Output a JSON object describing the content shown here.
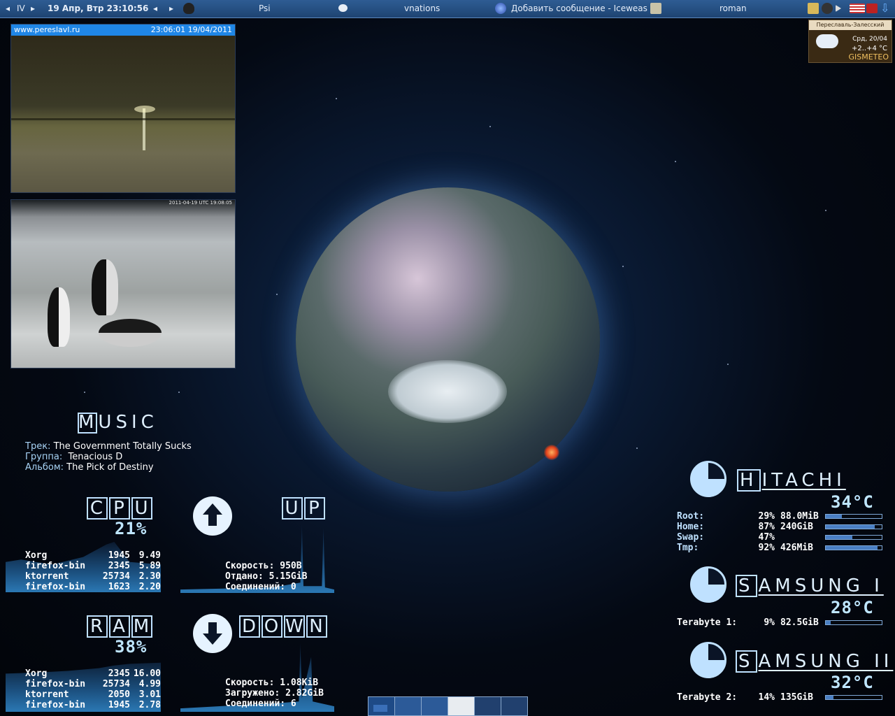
{
  "panel": {
    "desktop": "IV",
    "clock": "19 Апр, Втр 23:10:56",
    "tasks": [
      "Psi",
      "vnations",
      "Добавить сообщение - Iceweas",
      "roman"
    ]
  },
  "weather": {
    "city": "Переславль-Залесский",
    "date": "Срд, 20/04",
    "temp": "+2..+4 °C",
    "brand": "GISMETEO"
  },
  "webcam1": {
    "site": "www.pereslavl.ru",
    "timestamp": "23:06:01 19/04/2011"
  },
  "webcam2": {
    "timestamp": "2011-04-19 UTC 19:08:05"
  },
  "music": {
    "header": "MUSIC",
    "track_label": "Трек:",
    "track": "The Government Totally Sucks",
    "group_label": "Группа:",
    "group": "Tenacious D",
    "album_label": "Альбом:",
    "album": "The Pick of Destiny"
  },
  "cpu": {
    "header": [
      "C",
      "P",
      "U"
    ],
    "percent": "21%",
    "procs": [
      {
        "name": "Xorg",
        "pid": "1945",
        "val": "9.49"
      },
      {
        "name": "firefox-bin",
        "pid": "2345",
        "val": "5.89"
      },
      {
        "name": "ktorrent",
        "pid": "25734",
        "val": "2.30"
      },
      {
        "name": "firefox-bin",
        "pid": "1623",
        "val": "2.20"
      }
    ]
  },
  "ram": {
    "header": [
      "R",
      "A",
      "M"
    ],
    "percent": "38%",
    "procs": [
      {
        "name": "Xorg",
        "pid": "2345",
        "val": "16.00"
      },
      {
        "name": "firefox-bin",
        "pid": "25734",
        "val": "4.99"
      },
      {
        "name": "ktorrent",
        "pid": "2050",
        "val": "3.01"
      },
      {
        "name": "firefox-bin",
        "pid": "1945",
        "val": "2.78"
      }
    ]
  },
  "up": {
    "header": [
      "U",
      "P"
    ],
    "speed_label": "Скорость:",
    "speed": "950B",
    "total_label": "Отдано:",
    "total": "5.15GiB",
    "conn_label": "Соединений:",
    "conn": "0"
  },
  "down": {
    "header": [
      "D",
      "O",
      "W",
      "N"
    ],
    "speed_label": "Скорость:",
    "speed": "1.08KiB",
    "total_label": "Загружено:",
    "total": "2.82GiB",
    "conn_label": "Соединений:",
    "conn": "6"
  },
  "hitachi": {
    "name_first": "H",
    "name_rest": "ITACHI",
    "temp": "34°C",
    "rows": [
      {
        "label": "Root:",
        "pct": "29%",
        "size": "88.0MiB",
        "fill": 0.29
      },
      {
        "label": "Home:",
        "pct": "87%",
        "size": "240GiB",
        "fill": 0.87
      },
      {
        "label": "Swap:",
        "pct": "47%",
        "size": "",
        "fill": 0.47
      },
      {
        "label": "Tmp:",
        "pct": "92%",
        "size": "426MiB",
        "fill": 0.92
      }
    ]
  },
  "samsung1": {
    "name_first": "S",
    "name_rest": "AMSUNG I",
    "temp": "28°C",
    "label": "Terabyte 1:",
    "pct": "9%",
    "size": "82.5GiB",
    "fill": 0.09
  },
  "samsung2": {
    "name_first": "S",
    "name_rest": "AMSUNG II",
    "temp": "32°C",
    "label": "Terabyte 2:",
    "pct": "14%",
    "size": "135GiB",
    "fill": 0.14
  },
  "colors": {
    "accent": "#bfe1ff",
    "panel": "#2e5c93",
    "graph": "#2b78b4"
  }
}
